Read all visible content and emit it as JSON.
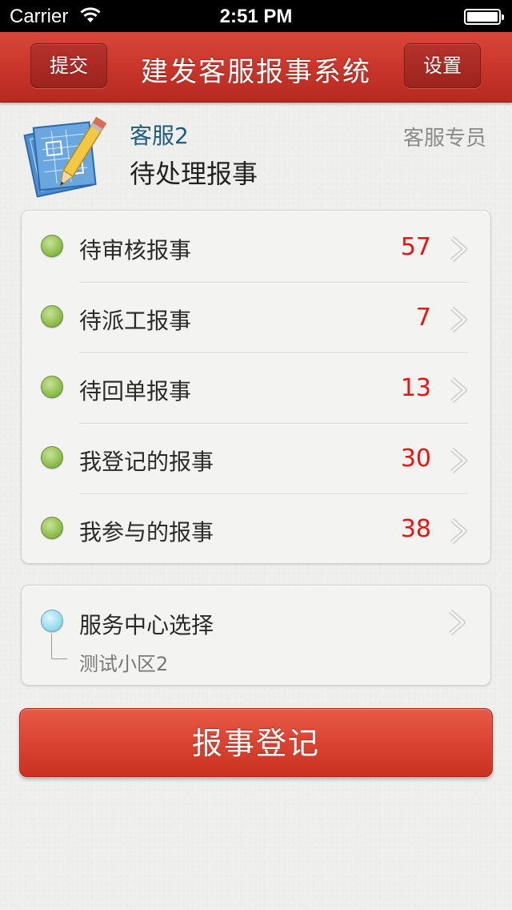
{
  "status_bar": {
    "carrier": "Carrier",
    "time": "2:51 PM",
    "wifi_icon": "wifi-icon",
    "battery_icon": "battery-icon"
  },
  "nav": {
    "title": "建发客服报事系统",
    "left_button": "提交",
    "right_button": "设置"
  },
  "header": {
    "icon": "blueprint-pencil-icon",
    "user_name": "客服2",
    "user_role": "客服专员",
    "section_title": "待处理报事"
  },
  "list": {
    "items": [
      {
        "label": "待审核报事",
        "count": "57"
      },
      {
        "label": "待派工报事",
        "count": "7"
      },
      {
        "label": "待回单报事",
        "count": "13"
      },
      {
        "label": "我登记的报事",
        "count": "30"
      },
      {
        "label": "我参与的报事",
        "count": "38"
      }
    ],
    "count_color": "#e8150f",
    "status_icon": "green-dot-icon",
    "chevron_icon": "chevron-right-icon"
  },
  "service_center": {
    "label": "服务中心选择",
    "selected": "测试小区2",
    "icon": "blue-dot-icon"
  },
  "main_button": {
    "label": "报事登记"
  },
  "colors": {
    "nav_red": "#c9352a",
    "button_red": "#dc4533",
    "user_name": "#1d5d7a"
  }
}
